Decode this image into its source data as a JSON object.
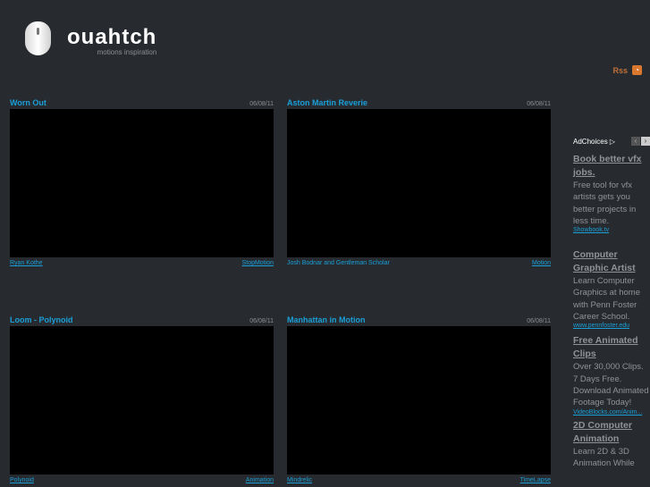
{
  "site": {
    "name": "ouahtch",
    "tagline": "motions inspiration",
    "rss_label": "Rss"
  },
  "videos": [
    {
      "title": "Worn Out",
      "date": "06/08/11",
      "author": "Ryan Kothe",
      "author_link": true,
      "category": "StopMotion"
    },
    {
      "title": "Aston Martin Reverie",
      "date": "06/08/11",
      "author": "Josh Bodnar and Gentleman Scholar",
      "author_link": false,
      "category": "Motion"
    },
    {
      "title": "Loom - Polynoid",
      "date": "06/08/11",
      "author": "Polynoid",
      "author_link": true,
      "category": "Animation"
    },
    {
      "title": "Manhattan in Motion",
      "date": "06/08/11",
      "author": "Mindrelic",
      "author_link": true,
      "category": "TimeLapse"
    }
  ],
  "ads": {
    "adchoices": "AdChoices ▷",
    "prev": "‹",
    "next": "›",
    "items": [
      {
        "title": "Book better vfx jobs.",
        "desc": "Free tool for vfx artists gets you better projects in less time.",
        "url": "Showbook.tv"
      },
      {
        "title": "Computer Graphic Artist",
        "desc": "Learn Computer Graphics at home with Penn Foster Career School.",
        "url": "www.pennfoster.edu"
      },
      {
        "title": "Free Animated Clips",
        "desc": "Over 30,000 Clips. 7 Days Free. Download Animated Footage Today!",
        "url": "VideoBlocks.com/Anim..."
      },
      {
        "title": "2D Computer Animation",
        "desc": "Learn 2D & 3D Animation While",
        "url": ""
      }
    ]
  }
}
